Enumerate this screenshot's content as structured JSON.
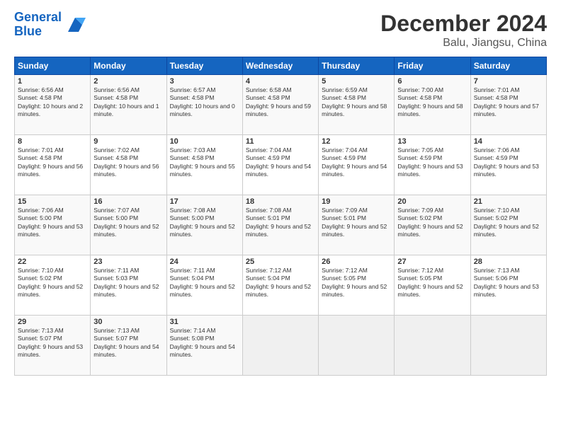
{
  "header": {
    "logo_line1": "General",
    "logo_line2": "Blue",
    "title": "December 2024",
    "subtitle": "Balu, Jiangsu, China"
  },
  "days_of_week": [
    "Sunday",
    "Monday",
    "Tuesday",
    "Wednesday",
    "Thursday",
    "Friday",
    "Saturday"
  ],
  "weeks": [
    [
      {
        "day": "1",
        "sunrise": "Sunrise: 6:56 AM",
        "sunset": "Sunset: 4:58 PM",
        "daylight": "Daylight: 10 hours and 2 minutes."
      },
      {
        "day": "2",
        "sunrise": "Sunrise: 6:56 AM",
        "sunset": "Sunset: 4:58 PM",
        "daylight": "Daylight: 10 hours and 1 minute."
      },
      {
        "day": "3",
        "sunrise": "Sunrise: 6:57 AM",
        "sunset": "Sunset: 4:58 PM",
        "daylight": "Daylight: 10 hours and 0 minutes."
      },
      {
        "day": "4",
        "sunrise": "Sunrise: 6:58 AM",
        "sunset": "Sunset: 4:58 PM",
        "daylight": "Daylight: 9 hours and 59 minutes."
      },
      {
        "day": "5",
        "sunrise": "Sunrise: 6:59 AM",
        "sunset": "Sunset: 4:58 PM",
        "daylight": "Daylight: 9 hours and 58 minutes."
      },
      {
        "day": "6",
        "sunrise": "Sunrise: 7:00 AM",
        "sunset": "Sunset: 4:58 PM",
        "daylight": "Daylight: 9 hours and 58 minutes."
      },
      {
        "day": "7",
        "sunrise": "Sunrise: 7:01 AM",
        "sunset": "Sunset: 4:58 PM",
        "daylight": "Daylight: 9 hours and 57 minutes."
      }
    ],
    [
      {
        "day": "8",
        "sunrise": "Sunrise: 7:01 AM",
        "sunset": "Sunset: 4:58 PM",
        "daylight": "Daylight: 9 hours and 56 minutes."
      },
      {
        "day": "9",
        "sunrise": "Sunrise: 7:02 AM",
        "sunset": "Sunset: 4:58 PM",
        "daylight": "Daylight: 9 hours and 56 minutes."
      },
      {
        "day": "10",
        "sunrise": "Sunrise: 7:03 AM",
        "sunset": "Sunset: 4:58 PM",
        "daylight": "Daylight: 9 hours and 55 minutes."
      },
      {
        "day": "11",
        "sunrise": "Sunrise: 7:04 AM",
        "sunset": "Sunset: 4:59 PM",
        "daylight": "Daylight: 9 hours and 54 minutes."
      },
      {
        "day": "12",
        "sunrise": "Sunrise: 7:04 AM",
        "sunset": "Sunset: 4:59 PM",
        "daylight": "Daylight: 9 hours and 54 minutes."
      },
      {
        "day": "13",
        "sunrise": "Sunrise: 7:05 AM",
        "sunset": "Sunset: 4:59 PM",
        "daylight": "Daylight: 9 hours and 53 minutes."
      },
      {
        "day": "14",
        "sunrise": "Sunrise: 7:06 AM",
        "sunset": "Sunset: 4:59 PM",
        "daylight": "Daylight: 9 hours and 53 minutes."
      }
    ],
    [
      {
        "day": "15",
        "sunrise": "Sunrise: 7:06 AM",
        "sunset": "Sunset: 5:00 PM",
        "daylight": "Daylight: 9 hours and 53 minutes."
      },
      {
        "day": "16",
        "sunrise": "Sunrise: 7:07 AM",
        "sunset": "Sunset: 5:00 PM",
        "daylight": "Daylight: 9 hours and 52 minutes."
      },
      {
        "day": "17",
        "sunrise": "Sunrise: 7:08 AM",
        "sunset": "Sunset: 5:00 PM",
        "daylight": "Daylight: 9 hours and 52 minutes."
      },
      {
        "day": "18",
        "sunrise": "Sunrise: 7:08 AM",
        "sunset": "Sunset: 5:01 PM",
        "daylight": "Daylight: 9 hours and 52 minutes."
      },
      {
        "day": "19",
        "sunrise": "Sunrise: 7:09 AM",
        "sunset": "Sunset: 5:01 PM",
        "daylight": "Daylight: 9 hours and 52 minutes."
      },
      {
        "day": "20",
        "sunrise": "Sunrise: 7:09 AM",
        "sunset": "Sunset: 5:02 PM",
        "daylight": "Daylight: 9 hours and 52 minutes."
      },
      {
        "day": "21",
        "sunrise": "Sunrise: 7:10 AM",
        "sunset": "Sunset: 5:02 PM",
        "daylight": "Daylight: 9 hours and 52 minutes."
      }
    ],
    [
      {
        "day": "22",
        "sunrise": "Sunrise: 7:10 AM",
        "sunset": "Sunset: 5:02 PM",
        "daylight": "Daylight: 9 hours and 52 minutes."
      },
      {
        "day": "23",
        "sunrise": "Sunrise: 7:11 AM",
        "sunset": "Sunset: 5:03 PM",
        "daylight": "Daylight: 9 hours and 52 minutes."
      },
      {
        "day": "24",
        "sunrise": "Sunrise: 7:11 AM",
        "sunset": "Sunset: 5:04 PM",
        "daylight": "Daylight: 9 hours and 52 minutes."
      },
      {
        "day": "25",
        "sunrise": "Sunrise: 7:12 AM",
        "sunset": "Sunset: 5:04 PM",
        "daylight": "Daylight: 9 hours and 52 minutes."
      },
      {
        "day": "26",
        "sunrise": "Sunrise: 7:12 AM",
        "sunset": "Sunset: 5:05 PM",
        "daylight": "Daylight: 9 hours and 52 minutes."
      },
      {
        "day": "27",
        "sunrise": "Sunrise: 7:12 AM",
        "sunset": "Sunset: 5:05 PM",
        "daylight": "Daylight: 9 hours and 52 minutes."
      },
      {
        "day": "28",
        "sunrise": "Sunrise: 7:13 AM",
        "sunset": "Sunset: 5:06 PM",
        "daylight": "Daylight: 9 hours and 53 minutes."
      }
    ],
    [
      {
        "day": "29",
        "sunrise": "Sunrise: 7:13 AM",
        "sunset": "Sunset: 5:07 PM",
        "daylight": "Daylight: 9 hours and 53 minutes."
      },
      {
        "day": "30",
        "sunrise": "Sunrise: 7:13 AM",
        "sunset": "Sunset: 5:07 PM",
        "daylight": "Daylight: 9 hours and 54 minutes."
      },
      {
        "day": "31",
        "sunrise": "Sunrise: 7:14 AM",
        "sunset": "Sunset: 5:08 PM",
        "daylight": "Daylight: 9 hours and 54 minutes."
      },
      null,
      null,
      null,
      null
    ]
  ]
}
